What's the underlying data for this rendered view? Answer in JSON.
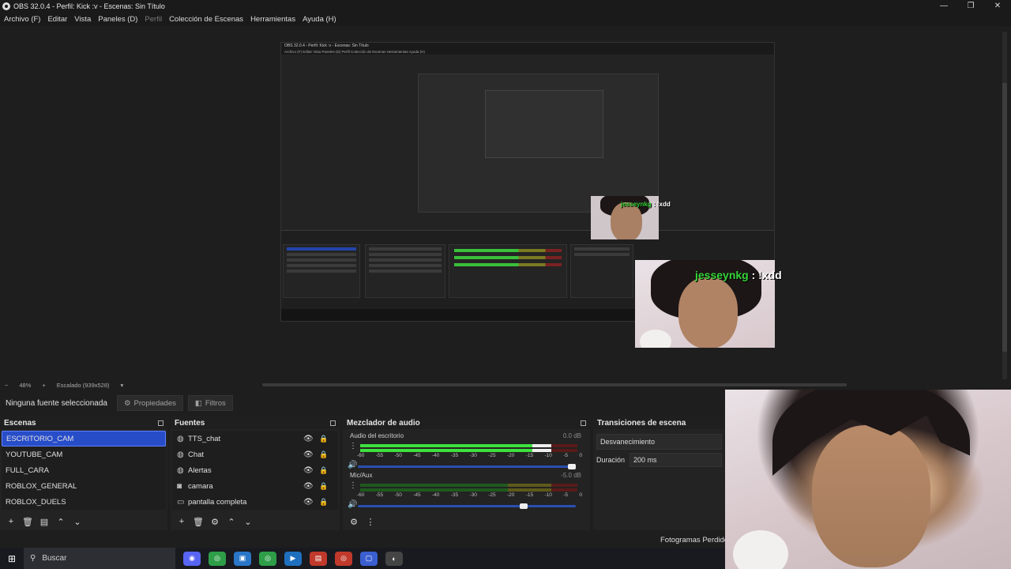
{
  "window": {
    "title": "OBS 32.0.4 - Perfil: Kick :v - Escenas: Sin Título",
    "controls": {
      "minimize": "—",
      "restore": "❐",
      "close": "✕"
    }
  },
  "menu": {
    "items": [
      "Archivo (F)",
      "Editar",
      "Vista",
      "Paneles (D)",
      "Perfil",
      "Colección de Escenas",
      "Herramientas",
      "Ayuda (H)"
    ]
  },
  "preview": {
    "nested_title": "OBS 32.0.4 - Perfil: Kick :v - Escenas: Sin Título",
    "nested_menu": "Archivo (F)   Editar   Vista   Paneles (D)   Perfil   Colección de Escenas   Herramientas   Ayuda (H)",
    "chat_user_big": "jesseynkg",
    "chat_msg_big": ": !xdd",
    "chat_user_mid": "jesseynkg",
    "chat_msg_mid": ": !xdd"
  },
  "zoombar": {
    "minus": "−",
    "zoom": "48%",
    "plus": "+",
    "scaling": "Escalado (939x528)",
    "dropdown": "▾"
  },
  "context": {
    "no_source": "Ninguna fuente seleccionada",
    "properties": "Propiedades",
    "filters": "Filtros"
  },
  "scenes": {
    "title": "Escenas",
    "items": [
      "ESCRITORIO_CAM",
      "YOUTUBE_CAM",
      "FULL_CARA",
      "ROBLOX_GENERAL",
      "ROBLOX_DUELS"
    ]
  },
  "sources": {
    "title": "Fuentes",
    "items": [
      "TTS_chat",
      "Chat",
      "Alertas",
      "camara",
      "pantalla completa"
    ]
  },
  "mixer": {
    "title": "Mezclador de audio",
    "channels": [
      {
        "name": "Audio del escritorio",
        "db": "0.0 dB",
        "level": 0.88,
        "volume": 1.0
      },
      {
        "name": "Mic/Aux",
        "db": "-5.0 dB",
        "level": 0.0,
        "volume": 0.78
      }
    ],
    "ticks": [
      "-60",
      "-55",
      "-50",
      "-45",
      "-40",
      "-35",
      "-30",
      "-25",
      "-20",
      "-15",
      "-10",
      "-5",
      "0"
    ]
  },
  "transitions": {
    "title": "Transiciones de escena",
    "selected": "Desvanecimiento",
    "duration_label": "Duración",
    "duration_value": "200 ms"
  },
  "status": {
    "frames_dropped": "Fotogramas Perdidos"
  },
  "taskbar": {
    "search_placeholder": "Buscar",
    "apps": [
      {
        "icon": "discord-icon",
        "color": "#5865f2",
        "glyph": "◉"
      },
      {
        "icon": "chrome-icon",
        "color": "#2e9e48",
        "glyph": "◎"
      },
      {
        "icon": "app-blue-icon",
        "color": "#2a77c9",
        "glyph": "▣"
      },
      {
        "icon": "chrome-icon",
        "color": "#2e9e48",
        "glyph": "◎"
      },
      {
        "icon": "terminal-icon",
        "color": "#1f6fbf",
        "glyph": "▶"
      },
      {
        "icon": "voicemeeter-icon",
        "color": "#c0392b",
        "glyph": "▤"
      },
      {
        "icon": "chrome-icon",
        "color": "#c0392b",
        "glyph": "◎"
      },
      {
        "icon": "window-icon",
        "color": "#3b5fd0",
        "glyph": "▢"
      },
      {
        "icon": "obs-icon",
        "color": "#444",
        "glyph": "◐"
      }
    ]
  }
}
